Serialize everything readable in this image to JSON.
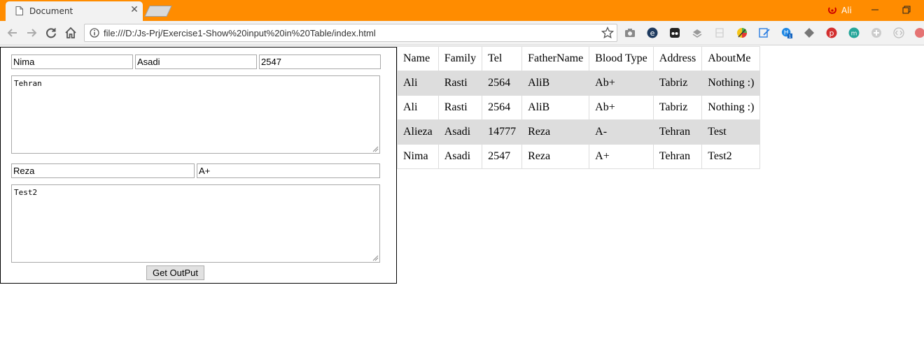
{
  "browser": {
    "tab_title": "Document",
    "tab_close": "✕",
    "profile_name": "Ali",
    "url": "file:///D:/Js-Prj/Exercise1-Show%20input%20in%20Table/index.html",
    "extension_badge": "1"
  },
  "form": {
    "name": "Nima",
    "family": "Asadi",
    "tel": "2547",
    "address": "Tehran",
    "father_name": "Reza",
    "blood_type": "A+",
    "about_me": "Test2",
    "submit_label": "Get OutPut"
  },
  "table": {
    "headers": [
      "Name",
      "Family",
      "Tel",
      "FatherName",
      "Blood Type",
      "Address",
      "AboutMe"
    ],
    "rows": [
      [
        "Ali",
        "Rasti",
        "2564",
        "AliB",
        "Ab+",
        "Tabriz",
        "Nothing :)"
      ],
      [
        "Ali",
        "Rasti",
        "2564",
        "AliB",
        "Ab+",
        "Tabriz",
        "Nothing :)"
      ],
      [
        "Alieza",
        "Asadi",
        "14777",
        "Reza",
        "A-",
        "Tehran",
        "Test"
      ],
      [
        "Nima",
        "Asadi",
        "2547",
        "Reza",
        "A+",
        "Tehran",
        "Test2"
      ]
    ]
  },
  "colors": {
    "titlebar": "#ff8c00",
    "row_stripe": "#dddddd"
  }
}
